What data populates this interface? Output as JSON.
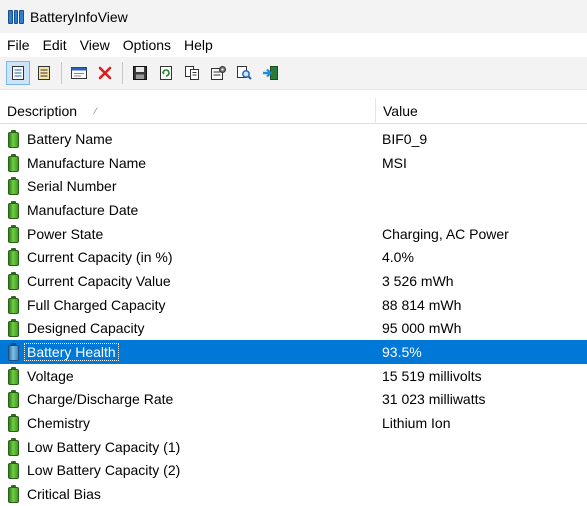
{
  "window": {
    "title": "BatteryInfoView"
  },
  "menu": [
    "File",
    "Edit",
    "View",
    "Options",
    "Help"
  ],
  "toolbar": [
    {
      "name": "html-report-icon",
      "pressed": true
    },
    {
      "name": "text-report-icon",
      "pressed": false
    },
    {
      "sep": true
    },
    {
      "name": "properties-window-icon",
      "pressed": false
    },
    {
      "name": "delete-icon",
      "pressed": false
    },
    {
      "sep": true
    },
    {
      "name": "save-icon",
      "pressed": false
    },
    {
      "name": "refresh-icon",
      "pressed": false
    },
    {
      "name": "copy-icon",
      "pressed": false
    },
    {
      "name": "properties-icon",
      "pressed": false
    },
    {
      "name": "find-icon",
      "pressed": false
    },
    {
      "name": "exit-icon",
      "pressed": false
    }
  ],
  "columns": {
    "description": "Description",
    "value": "Value"
  },
  "rows": [
    {
      "label": "Battery Name",
      "value": "BIF0_9"
    },
    {
      "label": "Manufacture Name",
      "value": "MSI"
    },
    {
      "label": "Serial Number",
      "value": ""
    },
    {
      "label": "Manufacture Date",
      "value": ""
    },
    {
      "label": "Power State",
      "value": "Charging, AC Power"
    },
    {
      "label": "Current Capacity (in %)",
      "value": "4.0%"
    },
    {
      "label": "Current Capacity Value",
      "value": "3 526 mWh"
    },
    {
      "label": "Full Charged Capacity",
      "value": "88 814 mWh"
    },
    {
      "label": "Designed Capacity",
      "value": "95 000 mWh"
    },
    {
      "label": "Battery Health",
      "value": "93.5%",
      "selected": true
    },
    {
      "label": "Voltage",
      "value": "15 519 millivolts"
    },
    {
      "label": "Charge/Discharge Rate",
      "value": "31 023 milliwatts"
    },
    {
      "label": "Chemistry",
      "value": "Lithium Ion"
    },
    {
      "label": "Low Battery Capacity (1)",
      "value": ""
    },
    {
      "label": "Low Battery Capacity (2)",
      "value": ""
    },
    {
      "label": "Critical Bias",
      "value": ""
    }
  ],
  "colors": {
    "selection": "#0078d7",
    "battery_green": "#4caf2f",
    "delete_red": "#e01b1b"
  }
}
